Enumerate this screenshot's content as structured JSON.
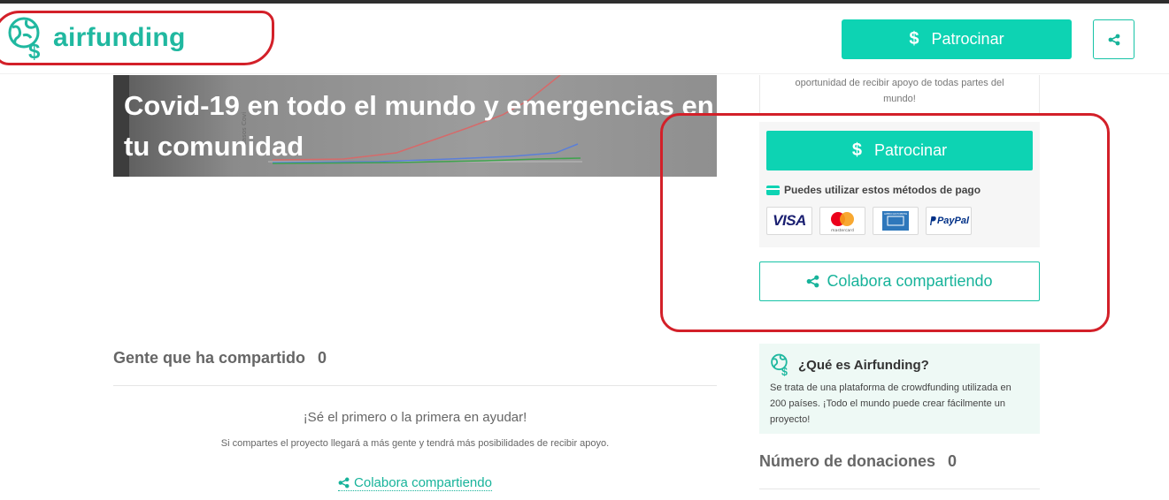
{
  "header": {
    "logo_text": "airfunding",
    "sponsor_label": "Patrocinar",
    "sponsor_symbol": "$",
    "share_icon": "share-icon"
  },
  "hero": {
    "title": "Covid-19 en todo el mundo y emergencias en tu comunidad"
  },
  "sidebar": {
    "top_text": "oportunidad de recibir apoyo de todas partes del mundo!",
    "pay_button_label": "Patrocinar",
    "pay_button_symbol": "$",
    "payment_methods_label": "Puedes utilizar estos métodos de pago",
    "payment_methods": [
      {
        "name": "visa-logo",
        "text": "VISA"
      },
      {
        "name": "mastercard-logo",
        "text": "mastercard"
      },
      {
        "name": "amex-logo",
        "text": "AMERICAN EXPRESS"
      },
      {
        "name": "paypal-logo",
        "text": "PayPal"
      }
    ],
    "collab_button_label": "Colabora compartiendo",
    "info": {
      "title": "¿Qué es Airfunding?",
      "text": "Se trata de una plataforma de crowdfunding utilizada en 200 países. ¡Todo el mundo puede crear fácilmente un proyecto!"
    },
    "donations_label": "Número de donaciones",
    "donations_count": "0"
  },
  "shared": {
    "title": "Gente que ha compartido",
    "count": "0",
    "first_help": "¡Sé el primero o la primera en ayudar!",
    "note": "Si compartes el proyecto llegará a más gente y tendrá más posibilidades de recibir apoyo.",
    "link_label": "Colabora compartiendo"
  },
  "colors": {
    "accent": "#0dd3b3",
    "accent_dark": "#17b39a",
    "annotation_red": "#d32029"
  }
}
